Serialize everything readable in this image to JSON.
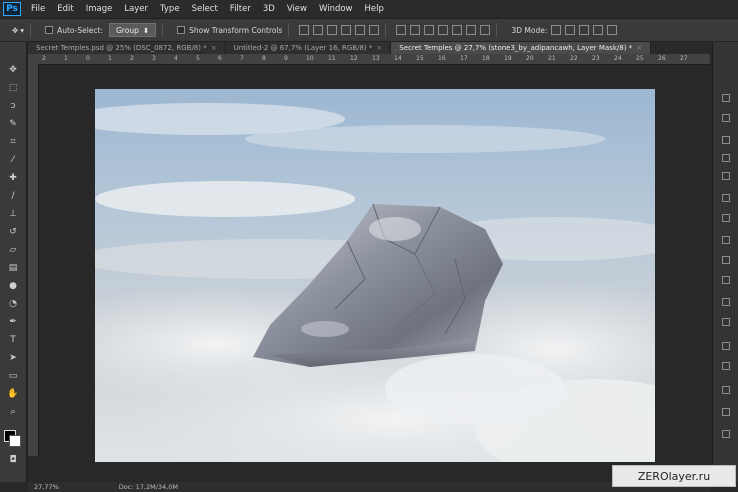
{
  "app": {
    "logo": "Ps"
  },
  "menu": [
    "File",
    "Edit",
    "Image",
    "Layer",
    "Type",
    "Select",
    "Filter",
    "3D",
    "View",
    "Window",
    "Help"
  ],
  "options": {
    "auto_select_label": "Auto-Select:",
    "auto_select_value": "Group",
    "show_transform_label": "Show Transform Controls",
    "mode_3d_label": "3D Mode:"
  },
  "tabs": [
    {
      "label": "Secret Temples.psd @ 25% (DSC_0872, RGB/8) *",
      "close": "×",
      "active": false
    },
    {
      "label": "Untitled-2 @ 67,7% (Layer 16, RGB/8) *",
      "close": "×",
      "active": false
    },
    {
      "label": "Secret Temples @ 27,7% (stone3_by_adipancawh, Layer Mask/8) *",
      "close": "×",
      "active": true
    }
  ],
  "ruler_ticks": [
    "2",
    "1",
    "0",
    "1",
    "2",
    "3",
    "4",
    "5",
    "6",
    "7",
    "8",
    "9",
    "10",
    "11",
    "12",
    "13",
    "14",
    "15",
    "16",
    "17",
    "18",
    "19",
    "20",
    "21",
    "22",
    "23",
    "24",
    "25",
    "26",
    "27"
  ],
  "status": {
    "zoom": "27,77%",
    "doc": "Doc: 17,2M/34,0M"
  },
  "watermark": "ZEROlayer.ru",
  "colors": {
    "foreground": "#000000",
    "background": "#ffffff"
  },
  "tools": [
    "move-icon",
    "marquee-icon",
    "lasso-icon",
    "quick-select-icon",
    "crop-icon",
    "eyedropper-icon",
    "healing-icon",
    "brush-icon",
    "stamp-icon",
    "history-brush-icon",
    "eraser-icon",
    "gradient-icon",
    "blur-icon",
    "dodge-icon",
    "pen-icon",
    "type-icon",
    "path-select-icon",
    "rectangle-icon",
    "hand-icon",
    "zoom-icon"
  ]
}
